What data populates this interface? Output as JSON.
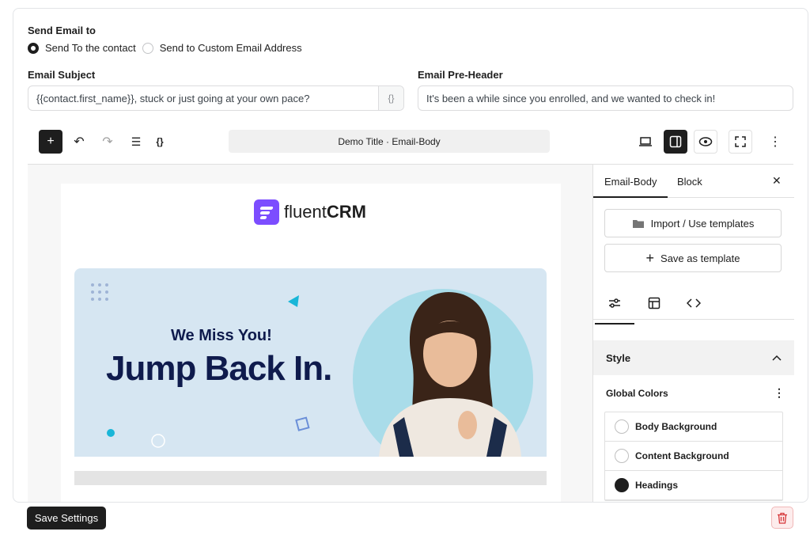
{
  "send_to": {
    "label": "Send Email to",
    "options": [
      {
        "label": "Send To the contact",
        "selected": true
      },
      {
        "label": "Send to Custom Email Address",
        "selected": false
      }
    ]
  },
  "subject": {
    "label": "Email Subject",
    "value": "{{contact.first_name}}, stuck or just going at your own pace?",
    "merge_icon": "{}"
  },
  "preheader": {
    "label": "Email Pre-Header",
    "value": "It's been a while since you enrolled, and we wanted to check in!"
  },
  "toolbar": {
    "doc_title": "Demo Title · Email-Body",
    "add_icon": "+",
    "undo_icon": "↶",
    "redo_icon": "↷",
    "outline_icon": "☰",
    "shortcode_icon": "{}",
    "more_icon": "⋮"
  },
  "email": {
    "logo_prefix": "fluent",
    "logo_suffix": "CRM",
    "banner_subtitle": "We Miss You!",
    "banner_title": "Jump Back In."
  },
  "sidebar": {
    "tabs": [
      "Email-Body",
      "Block"
    ],
    "close_icon": "✕",
    "import_label": "Import / Use templates",
    "save_template_label": "Save as template",
    "style_heading": "Style",
    "global_colors_label": "Global Colors",
    "colors": [
      {
        "label": "Body Background",
        "color": "#ffffff"
      },
      {
        "label": "Content Background",
        "color": "#ffffff"
      },
      {
        "label": "Headings",
        "color": "#1e1e1e"
      }
    ]
  },
  "footer": {
    "save_label": "Save Settings"
  },
  "colors": {
    "accent": "#1e1e1e",
    "brand": "#7c4dff",
    "banner_bg": "#d6e6f2",
    "danger": "#d63638"
  }
}
